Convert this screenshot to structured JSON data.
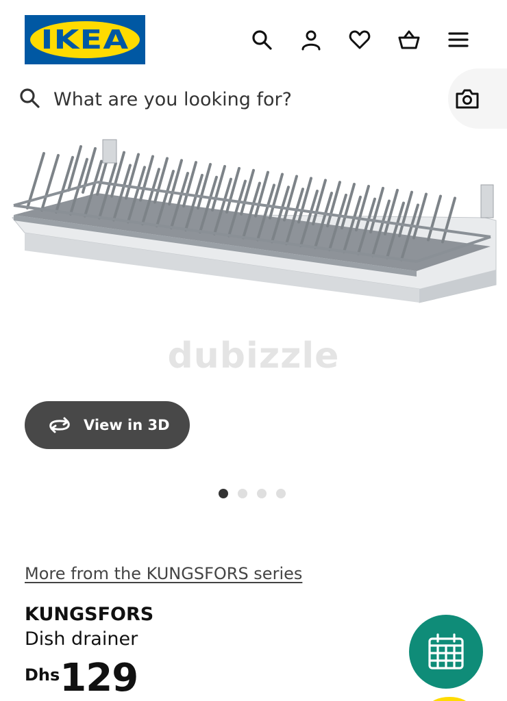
{
  "header": {
    "logo_text": "IKEA",
    "logo_mark": "®",
    "icons": [
      "search-icon",
      "profile-icon",
      "heart-icon",
      "basket-icon",
      "menu-icon"
    ]
  },
  "search": {
    "placeholder": "What are you looking for?"
  },
  "gallery": {
    "watermark": "dubizzle",
    "view_3d_label": "View in 3D",
    "dots_total": 4,
    "active_dot": 1
  },
  "product": {
    "series_link": "More from the KUNGSFORS series",
    "name": "KUNGSFORS",
    "description": "Dish drainer",
    "currency": "Dhs",
    "price": "129"
  },
  "colors": {
    "ikea_blue": "#0058a3",
    "ikea_yellow": "#ffdb00",
    "fab_green": "#0f8c78",
    "button_dark": "#484848"
  }
}
